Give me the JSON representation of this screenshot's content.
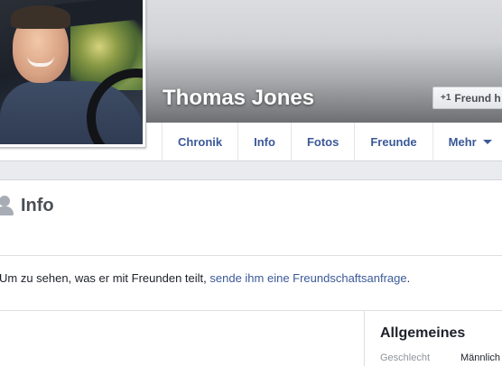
{
  "profile": {
    "name": "Thomas Jones",
    "add_friend_label": "Freund h",
    "add_friend_icon": "+1"
  },
  "nav": {
    "tabs": [
      {
        "label": "Chronik"
      },
      {
        "label": "Info"
      },
      {
        "label": "Fotos"
      },
      {
        "label": "Freunde"
      },
      {
        "label": "Mehr"
      }
    ]
  },
  "info": {
    "title": "Info",
    "message_prefix": "Um zu sehen, was er mit Freunden teilt, ",
    "message_link": "sende ihm eine Freundschaftsanfrage",
    "message_suffix": ".",
    "section_title": "Allgemeines",
    "fields": [
      {
        "label": "Geschlecht",
        "value": "Männlich"
      }
    ]
  },
  "colors": {
    "link": "#3b5998",
    "page_bg": "#e9ebee"
  }
}
